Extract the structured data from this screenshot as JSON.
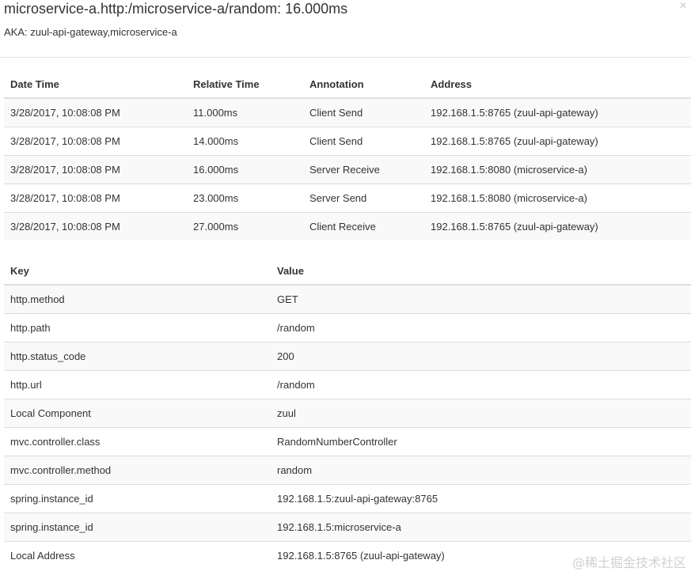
{
  "header": {
    "title": "microservice-a.http:/microservice-a/random: 16.000ms",
    "aka": "AKA: zuul-api-gateway,microservice-a",
    "close_glyph": "×"
  },
  "annotations": {
    "columns": [
      "Date Time",
      "Relative Time",
      "Annotation",
      "Address"
    ],
    "rows": [
      [
        "3/28/2017, 10:08:08 PM",
        "11.000ms",
        "Client Send",
        "192.168.1.5:8765 (zuul-api-gateway)"
      ],
      [
        "3/28/2017, 10:08:08 PM",
        "14.000ms",
        "Client Send",
        "192.168.1.5:8765 (zuul-api-gateway)"
      ],
      [
        "3/28/2017, 10:08:08 PM",
        "16.000ms",
        "Server Receive",
        "192.168.1.5:8080 (microservice-a)"
      ],
      [
        "3/28/2017, 10:08:08 PM",
        "23.000ms",
        "Server Send",
        "192.168.1.5:8080 (microservice-a)"
      ],
      [
        "3/28/2017, 10:08:08 PM",
        "27.000ms",
        "Client Receive",
        "192.168.1.5:8765 (zuul-api-gateway)"
      ]
    ]
  },
  "tags": {
    "columns": [
      "Key",
      "Value"
    ],
    "rows": [
      [
        "http.method",
        "GET"
      ],
      [
        "http.path",
        "/random"
      ],
      [
        "http.status_code",
        "200"
      ],
      [
        "http.url",
        "/random"
      ],
      [
        "Local Component",
        "zuul"
      ],
      [
        "mvc.controller.class",
        "RandomNumberController"
      ],
      [
        "mvc.controller.method",
        "random"
      ],
      [
        "spring.instance_id",
        "192.168.1.5:zuul-api-gateway:8765"
      ],
      [
        "spring.instance_id",
        "192.168.1.5:microservice-a"
      ],
      [
        "Local Address",
        "192.168.1.5:8765 (zuul-api-gateway)"
      ]
    ]
  },
  "watermark": "@稀土掘金技术社区"
}
